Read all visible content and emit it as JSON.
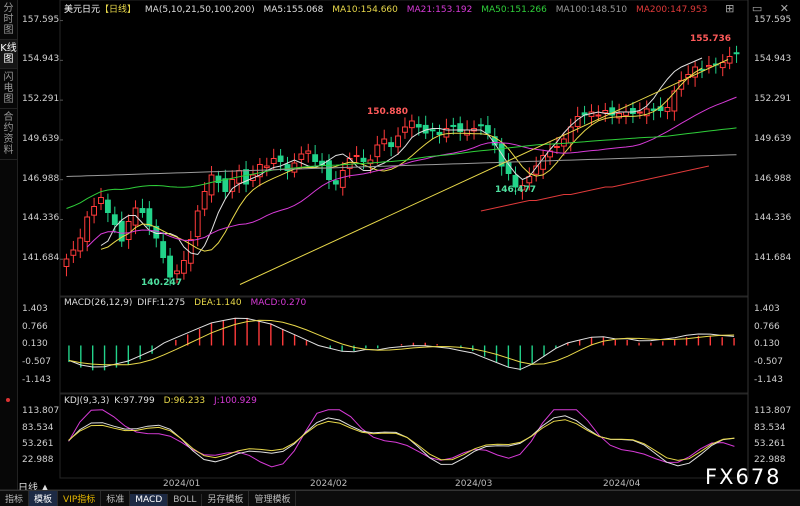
{
  "sidebar": {
    "tabs": [
      "分时图",
      "K线图",
      "闪电图",
      "合约资料"
    ],
    "active": 1
  },
  "header": {
    "symbol": "美元日元",
    "period_tag": "【日线】",
    "ma_title": "MA(5,10,21,50,100,200)",
    "ma_values": [
      {
        "label": "MA5:155.068",
        "color": "#e0e0e0"
      },
      {
        "label": "MA10:154.660",
        "color": "#e8d84a"
      },
      {
        "label": "MA21:153.192",
        "color": "#d63ad6"
      },
      {
        "label": "MA50:151.266",
        "color": "#2fcf3a"
      },
      {
        "label": "MA100:148.510",
        "color": "#9a9a9a"
      },
      {
        "label": "MA200:147.953",
        "color": "#e03a3a"
      }
    ]
  },
  "window_buttons": "⊞ ▭ ✕",
  "main_axis": {
    "ticks": [
      "157.595",
      "154.943",
      "152.291",
      "149.639",
      "146.988",
      "144.336",
      "141.684"
    ],
    "ylim": [
      139.5,
      158.3
    ]
  },
  "price_labels": {
    "high": "155.736",
    "mid": "150.880",
    "low_mid": "146.477",
    "low": "140.247"
  },
  "macd": {
    "title": "MACD(26,12,9)",
    "diff": "DIFF:1.275",
    "dea": "DEA:1.140",
    "macd": "MACD:0.270",
    "ticks": [
      "1.403",
      "0.766",
      "0.130",
      "-0.507",
      "-1.143"
    ]
  },
  "kdj": {
    "title": "KDJ(9,3,3)",
    "k": "K:97.799",
    "d": "D:96.233",
    "j": "J:100.929",
    "ticks": [
      "113.807",
      "83.534",
      "53.261",
      "22.988"
    ]
  },
  "period_label": "日线 ▲",
  "x_dates": [
    "2024/01",
    "2024/02",
    "2024/03",
    "2024/04"
  ],
  "bottom_tabs": [
    "指标",
    "模板",
    "VIP指标",
    "标准",
    "MACD",
    "BOLL",
    "另存模板",
    "管理模板"
  ],
  "brand": "FX678",
  "chart_data": {
    "type": "candlestick",
    "title": "美元日元【日线】",
    "series_close": [
      141.7,
      142.3,
      143.1,
      144.5,
      145.2,
      145.8,
      144.8,
      144.0,
      142.9,
      144.2,
      145.1,
      144.8,
      143.9,
      143.1,
      141.8,
      140.5,
      140.9,
      141.6,
      143.0,
      144.9,
      146.2,
      147.3,
      146.8,
      146.2,
      147.0,
      147.6,
      146.7,
      147.3,
      148.0,
      147.9,
      148.4,
      148.2,
      147.6,
      148.1,
      148.7,
      148.9,
      148.2,
      148.0,
      147.0,
      146.7,
      147.6,
      148.4,
      148.6,
      148.2,
      148.3,
      149.3,
      149.7,
      149.2,
      149.9,
      150.5,
      150.9,
      150.5,
      150.1,
      150.3,
      150.0,
      150.4,
      150.6,
      150.2,
      150.3,
      150.4,
      150.6,
      150.1,
      149.3,
      147.9,
      147.4,
      146.5,
      146.6,
      147.2,
      147.9,
      148.6,
      148.9,
      149.2,
      149.7,
      150.5,
      151.2,
      151.3,
      151.5,
      151.3,
      151.6,
      151.3,
      151.4,
      151.5,
      151.4,
      151.5,
      151.7,
      151.6,
      151.6,
      151.8,
      152.9,
      153.6,
      154.0,
      154.5,
      154.3,
      154.6,
      154.7,
      154.8,
      155.2,
      155.4
    ],
    "ma_series": {
      "MA5": [
        142.6,
        142.9,
        143.8,
        144.3,
        144.6,
        144.6,
        144.1,
        143.6,
        143.4,
        143.4,
        143.4,
        143.2,
        142.5,
        142.1,
        142.0,
        142.6,
        143.6,
        144.8,
        145.7,
        146.4,
        146.7,
        146.9,
        147.1,
        147.3,
        147.6,
        147.8,
        147.9,
        148.1,
        148.3,
        148.1,
        147.9,
        147.8,
        148.0,
        148.3,
        148.6,
        148.7,
        148.4,
        147.9,
        147.6,
        147.6,
        147.9,
        148.1,
        148.4,
        148.7,
        149.2,
        149.8,
        150.1,
        150.3,
        150.4,
        150.4,
        150.3,
        150.3,
        150.3,
        150.3,
        150.3,
        150.3,
        150.0,
        149.4,
        148.7,
        148.0,
        147.4,
        147.0,
        147.2,
        147.8,
        148.4,
        149.0,
        149.5,
        150.1,
        150.6,
        151.0,
        151.3,
        151.4,
        151.5,
        151.4,
        151.4,
        151.5,
        151.5,
        151.5,
        151.6,
        151.9,
        152.4,
        153.1,
        153.7,
        154.2,
        154.5,
        154.7,
        154.9,
        155.1
      ],
      "MA200": [
        144.9,
        145.0,
        145.1,
        145.2,
        145.3,
        145.4,
        145.5,
        145.6,
        145.6,
        145.7,
        145.8,
        145.9,
        146.0,
        146.0,
        146.1,
        146.2,
        146.3,
        146.4,
        146.5,
        146.5,
        146.6,
        146.7,
        146.8,
        146.9,
        147.0,
        147.1,
        147.2,
        147.3,
        147.4,
        147.5,
        147.6,
        147.7,
        147.8,
        147.9
      ]
    },
    "annotations": [
      {
        "text": "155.736",
        "type": "high"
      },
      {
        "text": "150.880",
        "type": "high"
      },
      {
        "text": "146.477",
        "type": "low"
      },
      {
        "text": "140.247",
        "type": "low"
      }
    ],
    "macd_hist": [
      -0.6,
      -0.8,
      -0.9,
      -0.9,
      -0.8,
      -0.7,
      -0.5,
      -0.3,
      0.0,
      0.2,
      0.4,
      0.6,
      0.8,
      0.9,
      1.0,
      1.0,
      0.9,
      0.8,
      0.6,
      0.4,
      0.2,
      0.0,
      -0.1,
      -0.2,
      -0.2,
      -0.1,
      -0.1,
      0.0,
      0.05,
      0.1,
      0.1,
      0.05,
      0.0,
      -0.1,
      -0.2,
      -0.4,
      -0.6,
      -0.8,
      -0.9,
      -0.7,
      -0.4,
      -0.1,
      0.1,
      0.2,
      0.3,
      0.3,
      0.2,
      0.2,
      0.1,
      0.1,
      0.15,
      0.2,
      0.3,
      0.35,
      0.35,
      0.3,
      0.27
    ],
    "kdj_ylim": [
      0,
      125
    ]
  }
}
